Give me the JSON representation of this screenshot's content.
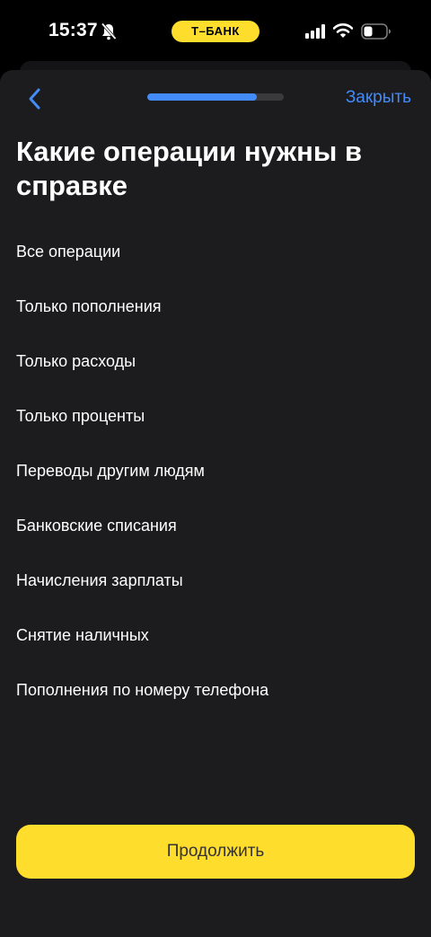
{
  "status_bar": {
    "time": "15:37",
    "carrier": "Т–БАНК",
    "icons": [
      "bell-slash-icon",
      "cellular-signal-icon",
      "wifi-icon",
      "battery-icon"
    ]
  },
  "header": {
    "back_icon": "chevron-left-icon",
    "progress": 0.8,
    "close_label": "Закрыть"
  },
  "title": "Какие операции нужны в справке",
  "options": [
    {
      "label": "Все операции"
    },
    {
      "label": "Только пополнения"
    },
    {
      "label": "Только расходы"
    },
    {
      "label": "Только проценты"
    },
    {
      "label": "Переводы другим людям"
    },
    {
      "label": "Банковские списания"
    },
    {
      "label": "Начисления зарплаты"
    },
    {
      "label": "Снятие наличных"
    },
    {
      "label": "Пополнения по номеру телефона"
    }
  ],
  "continue_label": "Продолжить",
  "colors": {
    "accent_blue": "#428bf9",
    "brand_yellow": "#ffdd2d",
    "sheet_background": "#1c1c1e"
  }
}
